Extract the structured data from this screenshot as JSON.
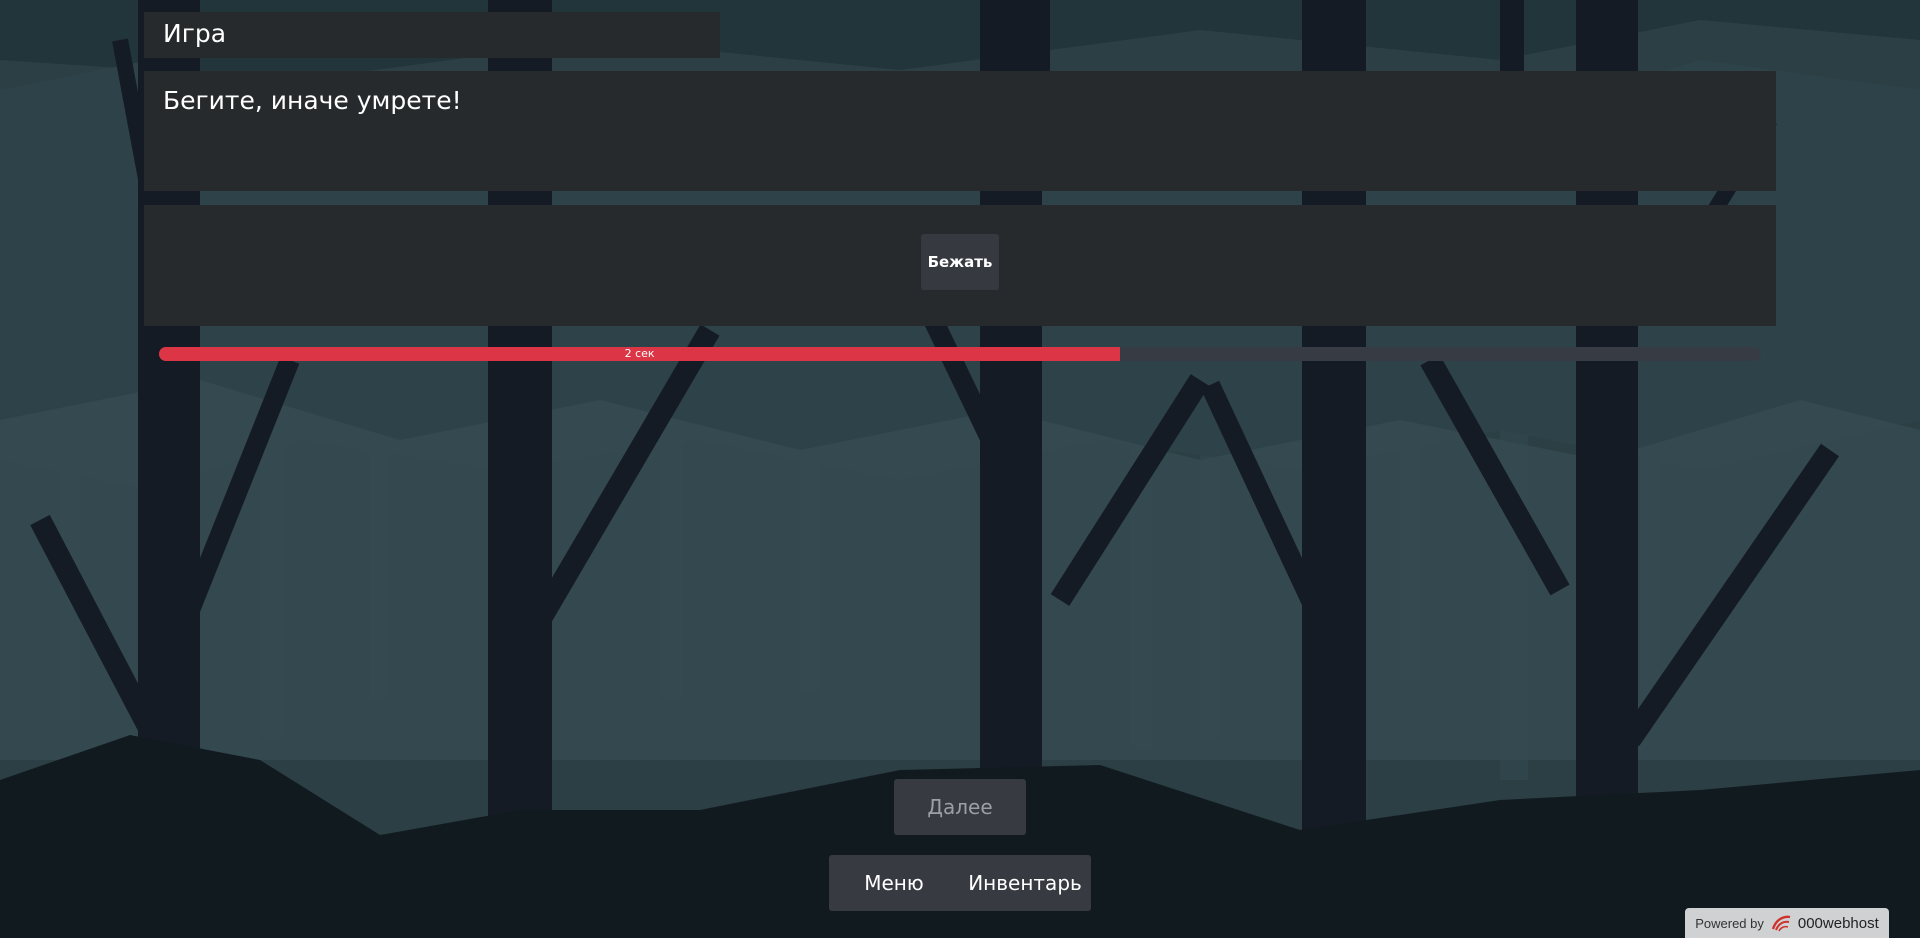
{
  "header": {
    "title": "Игра"
  },
  "message": {
    "text": "Бегите, иначе умрете!"
  },
  "actions": [
    {
      "label": "Бежать"
    }
  ],
  "timer": {
    "label": "2 сек",
    "progress": 0.6,
    "color": "#dc3545"
  },
  "navigation": {
    "next_label": "Далее",
    "menu_label": "Меню",
    "inventory_label": "Инвентарь"
  },
  "footer": {
    "powered_text": "Powered by",
    "host_name": "000webhost",
    "logo_icon": "000webhost-logo-icon"
  },
  "colors": {
    "panel": "#262a2d",
    "button": "#373a40",
    "timer_fill": "#dc3545",
    "timer_track": "#373b44"
  }
}
